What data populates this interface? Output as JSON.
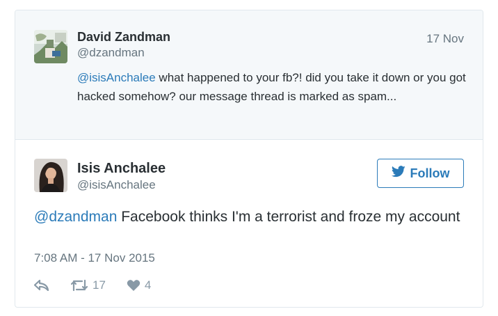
{
  "in_reply_to": {
    "name": "David Zandman",
    "handle": "@dzandman",
    "date": "17 Nov",
    "mention": "@isisAnchalee",
    "text": " what happened to your fb?! did you take it down or you got hacked somehow? our message thread is marked as spam..."
  },
  "tweet": {
    "name": "Isis Anchalee",
    "handle": "@isisAnchalee",
    "follow_label": "Follow",
    "mention": "@dzandman",
    "text": " Facebook thinks I'm a terrorist and froze my account",
    "timestamp": "7:08 AM - 17 Nov 2015",
    "retweet_count": "17",
    "like_count": "4"
  },
  "icons": {
    "reply": "reply-icon",
    "retweet": "retweet-icon",
    "like": "heart-icon",
    "follow": "twitter-bird-icon"
  },
  "colors": {
    "link": "#2b7bb9",
    "muted": "#66757f",
    "icon": "#8899a6",
    "context_bg": "#f5f8fa",
    "border": "#e1e8ed"
  }
}
